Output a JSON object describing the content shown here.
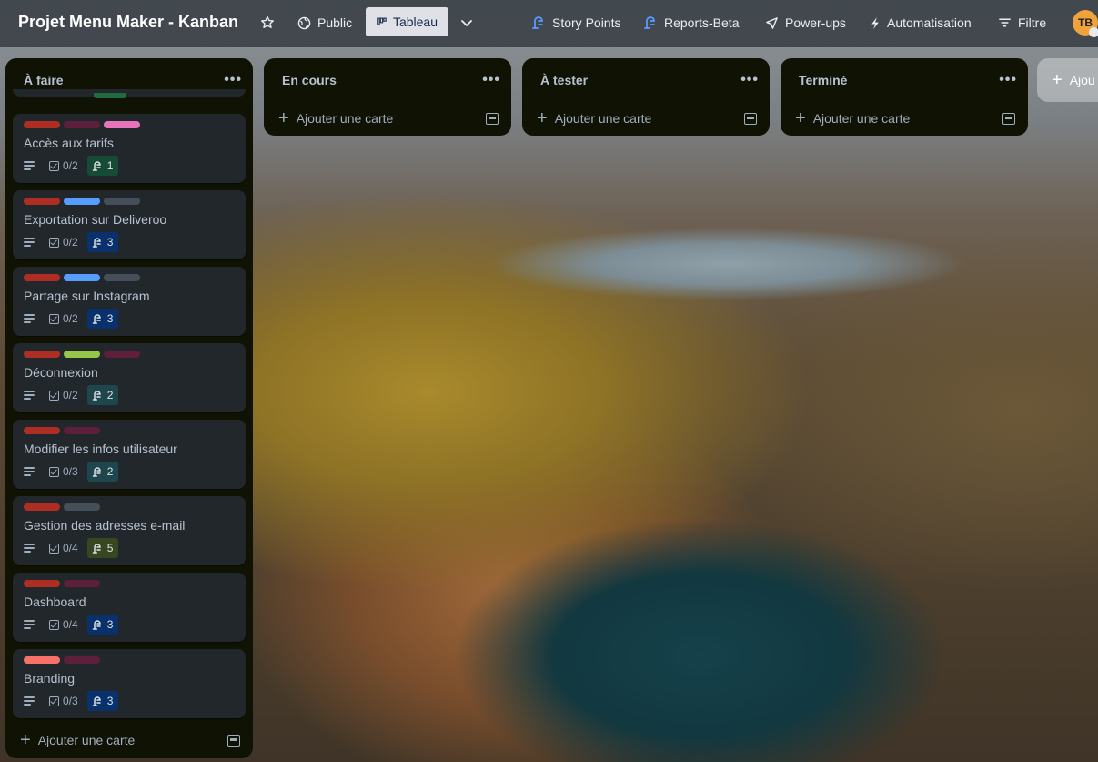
{
  "header": {
    "board_title": "Projet Menu Maker - Kanban",
    "visibility_label": "Public",
    "view_label": "Tableau",
    "story_points_label": "Story Points",
    "reports_label": "Reports-Beta",
    "powerups_label": "Power-ups",
    "automation_label": "Automatisation",
    "filter_label": "Filtre",
    "avatar_initials": "TB"
  },
  "lists": [
    {
      "title": "À faire",
      "add_label": "Ajouter une carte",
      "cards": [
        {
          "title": "Accès aux tarifs",
          "labels": [
            "#ae2e24",
            "#5d1f3c",
            "#e774bb"
          ],
          "checklist": "0/2",
          "points": "1",
          "points_color": "#164b35"
        },
        {
          "title": "Exportation sur Deliveroo",
          "labels": [
            "#ae2e24",
            "#579dff",
            "#454f59"
          ],
          "checklist": "0/2",
          "points": "3",
          "points_color": "#09326c"
        },
        {
          "title": "Partage sur Instagram",
          "labels": [
            "#ae2e24",
            "#579dff",
            "#454f59"
          ],
          "checklist": "0/2",
          "points": "3",
          "points_color": "#09326c"
        },
        {
          "title": "Déconnexion",
          "labels": [
            "#ae2e24",
            "#94c748",
            "#5d1f3c"
          ],
          "checklist": "0/2",
          "points": "2",
          "points_color": "#1d474c"
        },
        {
          "title": "Modifier les infos utilisateur",
          "labels": [
            "#ae2e24",
            "#5d1f3c"
          ],
          "checklist": "0/3",
          "points": "2",
          "points_color": "#1d474c"
        },
        {
          "title": "Gestion des adresses e-mail",
          "labels": [
            "#ae2e24",
            "#454f59"
          ],
          "checklist": "0/4",
          "points": "5",
          "points_color": "#37471f"
        },
        {
          "title": "Dashboard",
          "labels": [
            "#ae2e24",
            "#5d1f3c"
          ],
          "checklist": "0/4",
          "points": "3",
          "points_color": "#09326c"
        },
        {
          "title": "Branding",
          "labels": [
            "#f87168",
            "#5d1f3c"
          ],
          "checklist": "0/3",
          "points": "3",
          "points_color": "#09326c"
        }
      ]
    },
    {
      "title": "En cours",
      "add_label": "Ajouter une carte"
    },
    {
      "title": "À tester",
      "add_label": "Ajouter une carte"
    },
    {
      "title": "Terminé",
      "add_label": "Ajouter une carte"
    }
  ],
  "add_list_label": "Ajou",
  "icons": {
    "star": "star-icon",
    "globe": "globe-icon",
    "board": "board-icon",
    "chevron": "chevron-down-icon",
    "story_points": "story-points-icon",
    "powerups": "rocket-icon",
    "automation": "bolt-icon",
    "filter": "filter-icon"
  },
  "colors": {
    "list_bg": "#101204",
    "card_bg": "#22272b",
    "header_bg": "#3c4248",
    "avatar": "#f0a33a"
  }
}
